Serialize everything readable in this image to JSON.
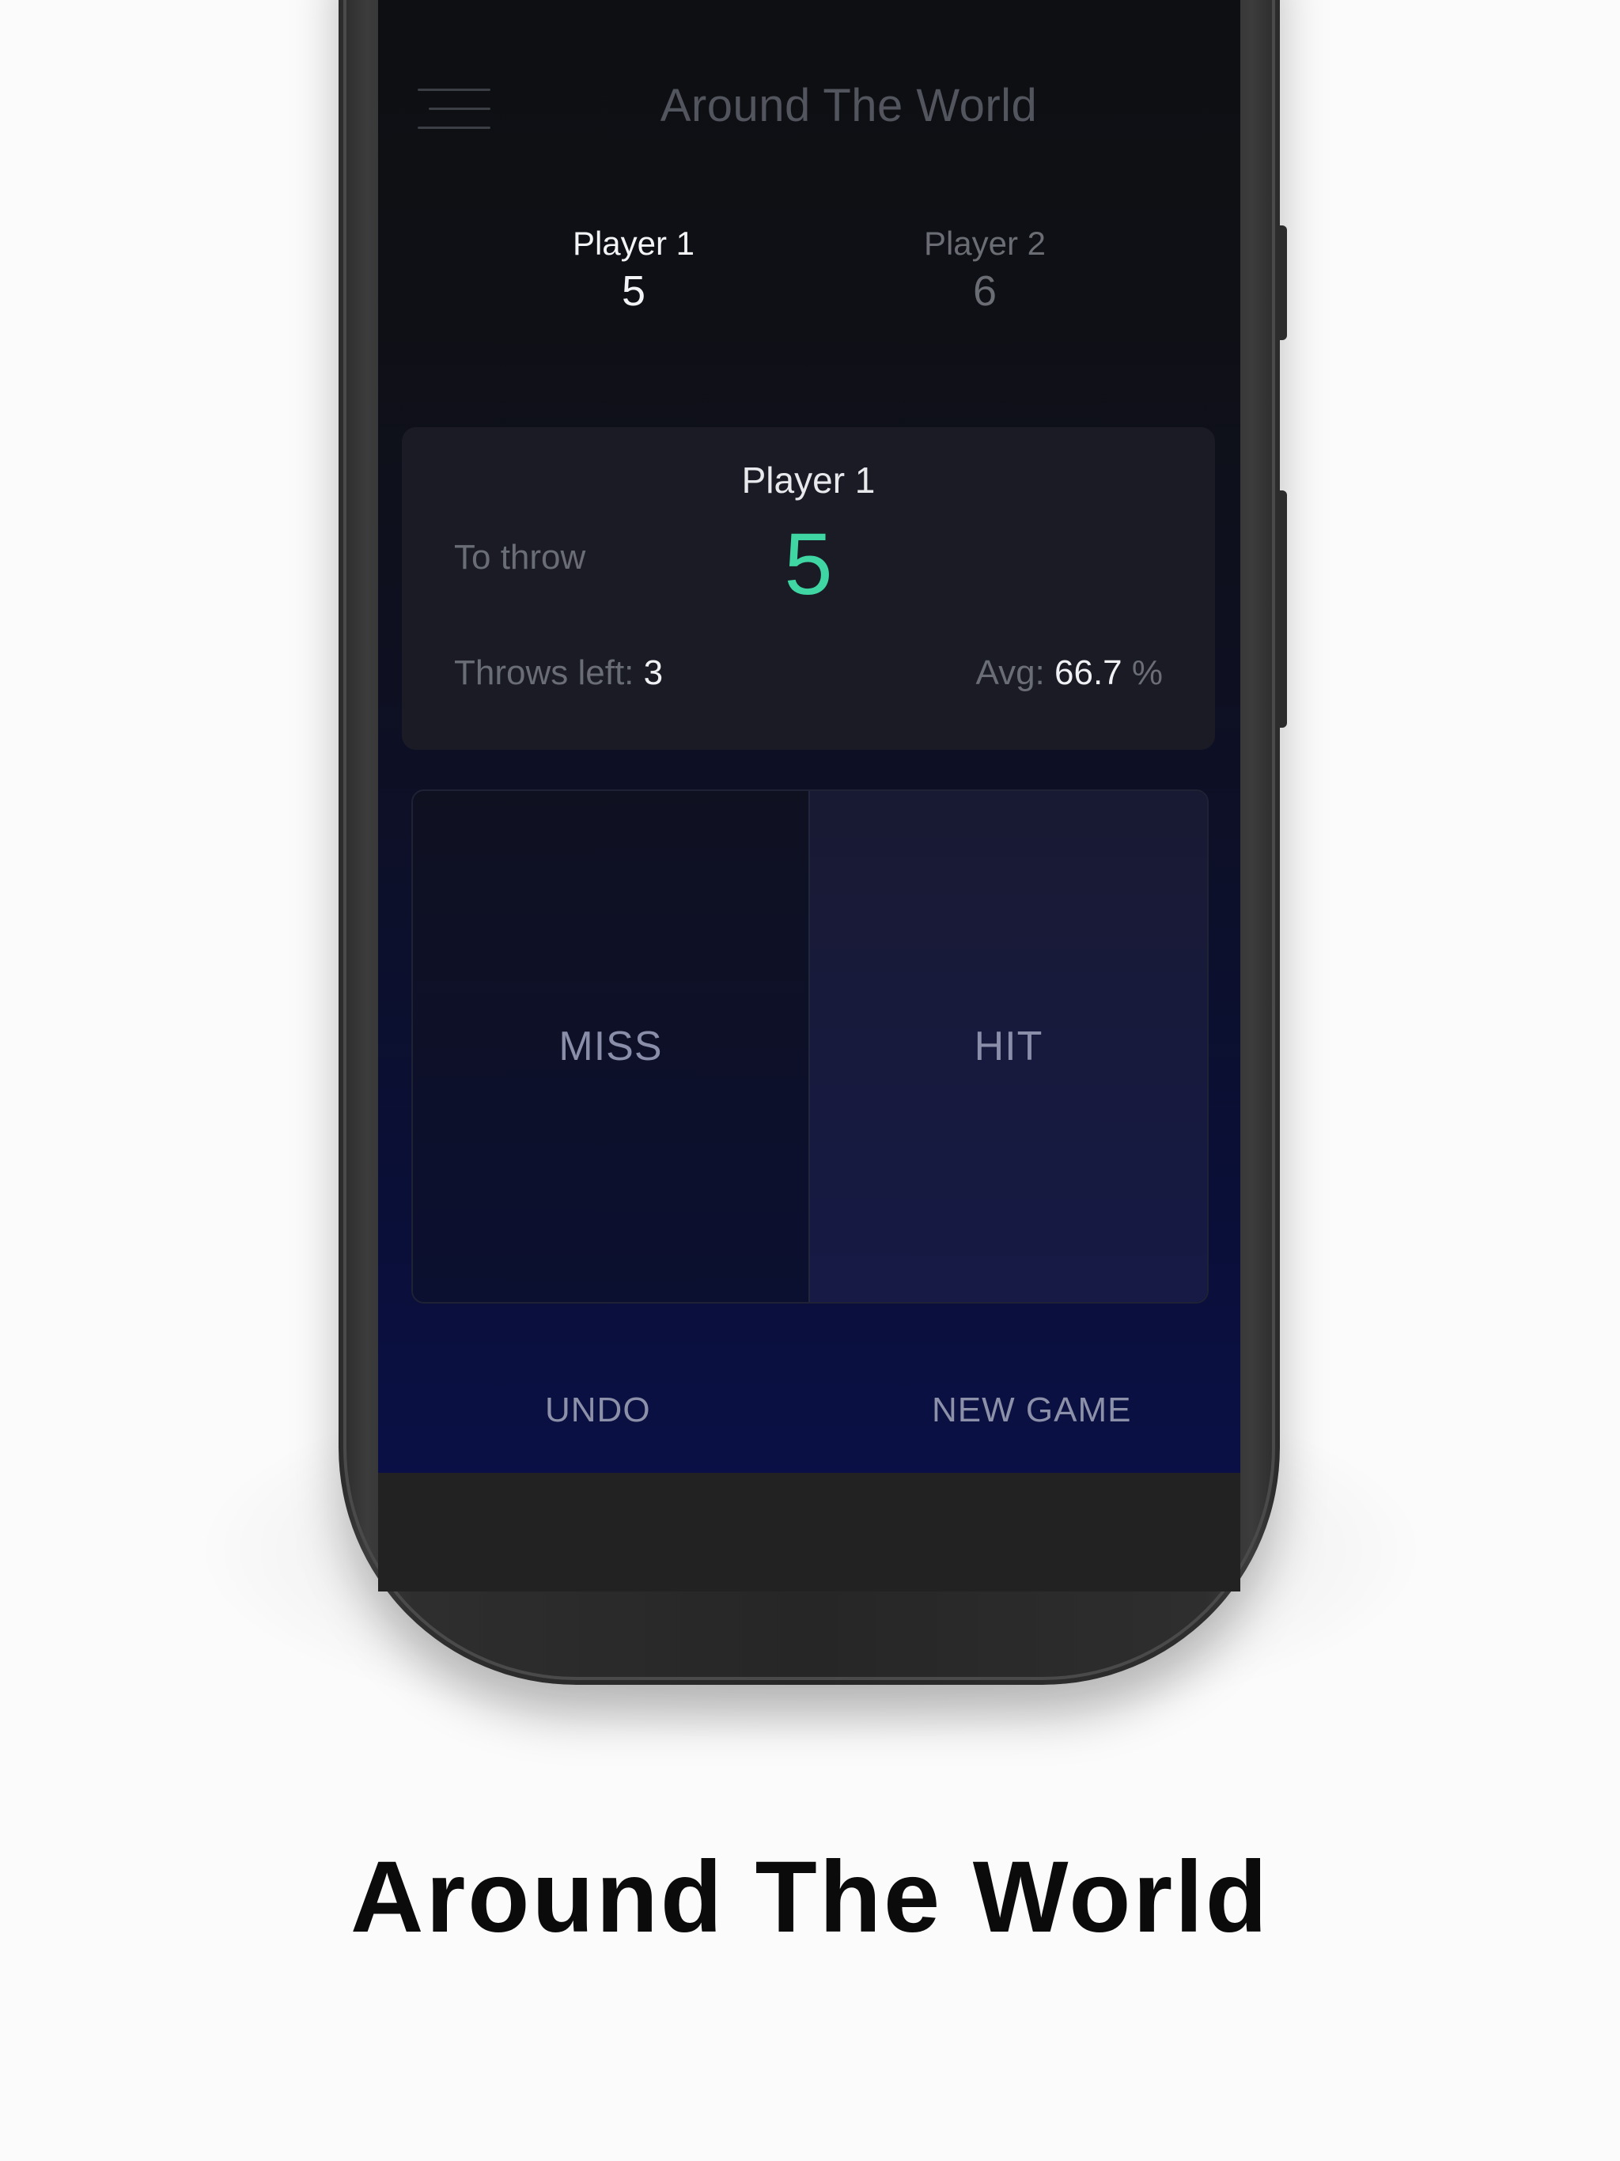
{
  "app": {
    "title": "Around The World"
  },
  "players": [
    {
      "name": "Player 1",
      "score": "5",
      "active": true
    },
    {
      "name": "Player 2",
      "score": "6",
      "active": false
    }
  ],
  "turn": {
    "current_player": "Player 1",
    "to_throw_label": "To throw",
    "to_throw_value": "5",
    "throws_left_label": "Throws left:",
    "throws_left_value": "3",
    "avg_label": "Avg:",
    "avg_value": "66.7",
    "avg_unit": "%"
  },
  "pad": {
    "miss_label": "MISS",
    "hit_label": "HIT"
  },
  "footer": {
    "undo_label": "UNDO",
    "new_game_label": "NEW GAME"
  },
  "caption": "Around The World",
  "colors": {
    "accent_green": "#3fd6a3",
    "screen_top": "#0e0f12",
    "screen_bottom": "#0a1045",
    "page_background": "#fbfbfb"
  },
  "icons": {
    "menu": "hamburger-menu-icon"
  }
}
